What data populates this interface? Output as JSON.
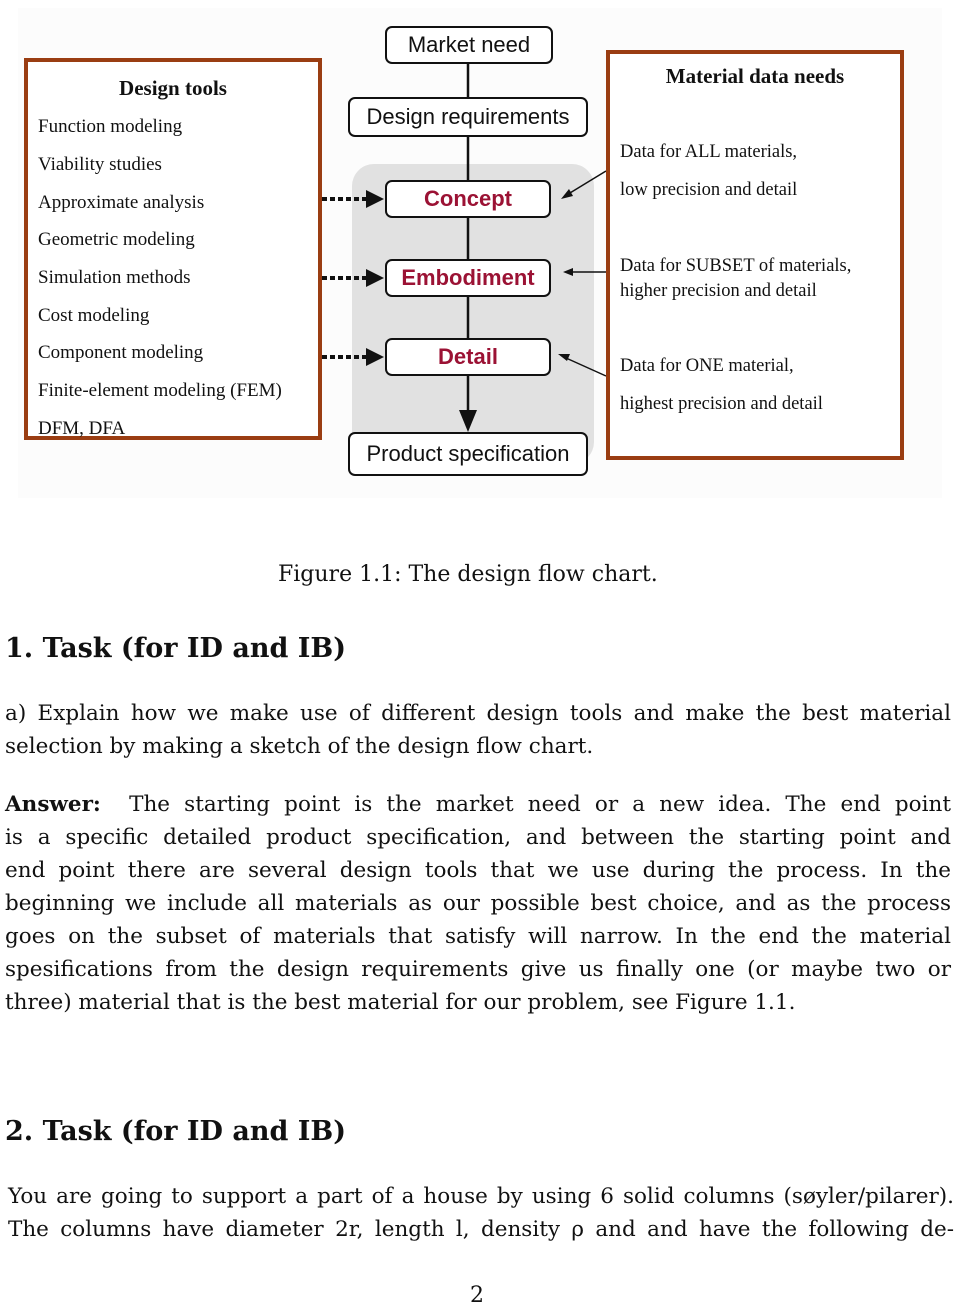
{
  "figure": {
    "design_tools": {
      "title": "Design tools",
      "items": [
        "Function modeling",
        "Viability studies",
        "Approximate analysis",
        "Geometric modeling",
        "Simulation methods",
        "Cost modeling",
        "Component modeling",
        "Finite-element modeling (FEM)",
        "DFM, DFA"
      ]
    },
    "flow": {
      "market_need": "Market need",
      "design_requirements": "Design requirements",
      "concept": "Concept",
      "embodiment": "Embodiment",
      "detail": "Detail",
      "product_specification": "Product specification"
    },
    "material_data_needs": {
      "title": "Material data needs",
      "items": [
        {
          "line1": "Data for ALL materials,",
          "line2": "low precision and detail"
        },
        {
          "line1": "Data for SUBSET of materials,",
          "line2": "higher precision and detail"
        },
        {
          "line1": "Data for ONE material,",
          "line2": "highest precision and detail"
        }
      ]
    },
    "colors": {
      "box_border": "#9a3d12",
      "stage_text": "#9b1234",
      "panel": "#e1e1e1"
    },
    "caption": "Figure 1.1: The design flow chart."
  },
  "task1": {
    "heading": "1. Task (for ID and IB)",
    "question_lines": [
      "a) Explain how we make use of different design tools and make the best material",
      "selection by making a sketch of the design flow chart."
    ],
    "answer_label": "Answer:",
    "answer_lines": [
      "The starting point is the market need or a new idea. The end point",
      "is a specific detailed product specification, and between the starting point and",
      "end point there are several design tools that we use during the process. In the",
      "beginning we include all materials as our possible best choice, and as the process",
      "goes on the subset of materials that satisfy will narrow. In the end the material",
      "spesifications from the design requirements give us finally one (or maybe two or",
      "three) material that is the best material for our problem, see Figure 1.1."
    ]
  },
  "task2": {
    "heading": "2. Task (for ID and IB)",
    "text_lines": [
      "You are going to support a part of a house by using 6 solid columns (søyler/pilarer).",
      "The columns have diameter 2r, length l, density ρ and and have the following de-"
    ]
  },
  "page_number": "2"
}
